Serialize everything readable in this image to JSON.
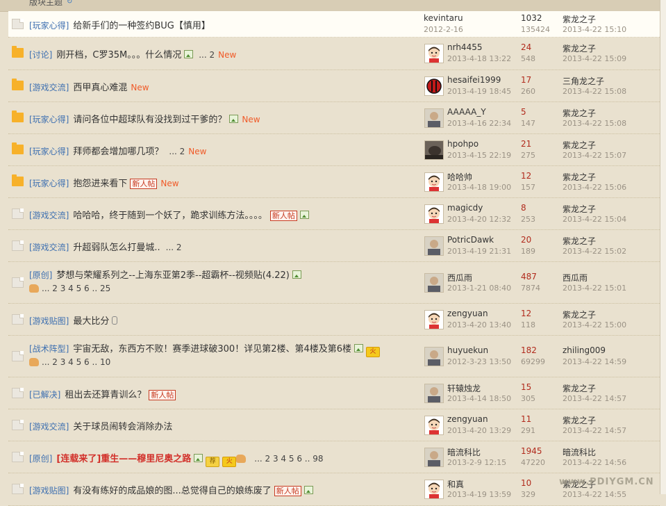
{
  "header": {
    "title": "版块主题"
  },
  "watermark": "www.PDIYGM.CN",
  "threads": [
    {
      "sticky": true,
      "folder": "gray",
      "category": "[玩家心得]",
      "title": "给新手们的一种签约BUG【慎用】",
      "author": "kevintaru",
      "date": "2012-2-16",
      "replies": "1032",
      "views": "135424",
      "last_user": "紫龙之子",
      "last_time": "2013-4-22 15:10",
      "avatar": "none"
    },
    {
      "folder": "yellow",
      "category": "[讨论]",
      "title": "刚开档，C罗35M。。。什么情况",
      "image": true,
      "pages": [
        "... 2"
      ],
      "new": "New",
      "author": "nrh4455",
      "date": "2013-4-18 13:22",
      "replies": "24",
      "views": "548",
      "last_user": "紫龙之子",
      "last_time": "2013-4-22 15:09",
      "avatar": "face"
    },
    {
      "folder": "yellow",
      "category": "[游戏交流]",
      "title": "西甲真心难混",
      "new": "New",
      "author": "hesaifei1999",
      "date": "2013-4-19 18:45",
      "replies": "17",
      "views": "260",
      "last_user": "三角龙之子",
      "last_time": "2013-4-22 15:08",
      "avatar": "milan"
    },
    {
      "folder": "yellow",
      "category": "[玩家心得]",
      "title": "请问各位中超球队有没找到过干爹的？",
      "image": true,
      "new": "New",
      "author": "AAAAA_Y",
      "date": "2013-4-16 22:34",
      "replies": "5",
      "views": "147",
      "last_user": "紫龙之子",
      "last_time": "2013-4-22 15:08",
      "avatar": "photo"
    },
    {
      "folder": "yellow",
      "category": "[玩家心得]",
      "title": "拜师都会增加哪几项？",
      "pages": [
        "... 2"
      ],
      "new": "New",
      "author": "hpohpo",
      "date": "2013-4-15 22:19",
      "replies": "21",
      "views": "275",
      "last_user": "紫龙之子",
      "last_time": "2013-4-22 15:07",
      "avatar": "dark"
    },
    {
      "folder": "yellow",
      "category": "[玩家心得]",
      "title": "抱怨进来看下",
      "badge": "新人帖",
      "new": "New",
      "author": "哈哈帅",
      "date": "2013-4-18 19:00",
      "replies": "12",
      "views": "157",
      "last_user": "紫龙之子",
      "last_time": "2013-4-22 15:06",
      "avatar": "face"
    },
    {
      "folder": "gray",
      "category": "[游戏交流]",
      "title": "哈哈哈，终于随到一个妖了，跪求训练方法。。。。",
      "badge": "新人帖",
      "image_after": true,
      "author": "magicdy",
      "date": "2013-4-20 12:32",
      "replies": "8",
      "views": "253",
      "last_user": "紫龙之子",
      "last_time": "2013-4-22 15:04",
      "avatar": "face"
    },
    {
      "folder": "gray",
      "category": "[游戏交流]",
      "title": "升超弱队怎么打曼城..",
      "pages": [
        "... 2"
      ],
      "author": "PotricDawk",
      "date": "2013-4-19 21:31",
      "replies": "20",
      "views": "189",
      "last_user": "紫龙之子",
      "last_time": "2013-4-22 15:02",
      "avatar": "photo"
    },
    {
      "folder": "gray",
      "category": "[原创]",
      "title": "梦想与荣耀系列之--上海东亚第2季--超霸杯--视频贴(4.22)",
      "image": true,
      "pages2": "... 2  3  4  5  6 .. 25",
      "author": "西瓜雨",
      "date": "2013-1-21 08:40",
      "replies": "487",
      "views": "7874",
      "last_user": "西瓜雨",
      "last_time": "2013-4-22 15:01",
      "avatar": "photo"
    },
    {
      "folder": "gray",
      "category": "[游戏贴图]",
      "title": "最大比分",
      "clip": true,
      "author": "zengyuan",
      "date": "2013-4-20 13:40",
      "replies": "12",
      "views": "118",
      "last_user": "紫龙之子",
      "last_time": "2013-4-22 15:00",
      "avatar": "face"
    },
    {
      "folder": "gray",
      "category": "[战术阵型]",
      "title": "宇宙无敌，东西方不败！赛季进球破300！详见第2楼、第4楼及第6楼",
      "image": true,
      "hot": "火",
      "pages2": "... 2  3  4  5  6 .. 10",
      "author": "huyuekun",
      "date": "2012-3-23 13:50",
      "replies": "182",
      "views": "69299",
      "last_user": "zhiling009",
      "last_time": "2013-4-22 14:59",
      "avatar": "photo"
    },
    {
      "folder": "gray",
      "category": "[已解决]",
      "title": "租出去还算青训么？",
      "badge": "新人帖",
      "author": "轩辕烛龙",
      "date": "2013-4-14 18:50",
      "replies": "15",
      "views": "305",
      "last_user": "紫龙之子",
      "last_time": "2013-4-22 14:57",
      "avatar": "photo"
    },
    {
      "folder": "gray",
      "category": "[游戏交流]",
      "title": "关于球员闹转会消除办法",
      "author": "zengyuan",
      "date": "2013-4-20 13:29",
      "replies": "11",
      "views": "291",
      "last_user": "紫龙之子",
      "last_time": "2013-4-22 14:57",
      "avatar": "face"
    },
    {
      "folder": "gray",
      "category": "[原创]",
      "title": "[连载来了]重生——穆里尼奥之路",
      "red": true,
      "image": true,
      "rec": "荐",
      "hot": "火",
      "hand": true,
      "pages": [
        "... 2  3  4  5  6 .. 98"
      ],
      "author": "暗流科比",
      "date": "2013-2-9 12:15",
      "replies": "1945",
      "views": "47220",
      "last_user": "暗流科比",
      "last_time": "2013-4-22 14:56",
      "avatar": "photo"
    },
    {
      "folder": "gray",
      "category": "[游戏贴图]",
      "title": "有没有练好的成品娘的图...总觉得自己的娘练废了",
      "badge": "新人帖",
      "image_after": true,
      "author": "和真",
      "date": "2013-4-19 13:59",
      "replies": "10",
      "views": "329",
      "last_user": "紫龙之子",
      "last_time": "2013-4-22 14:55",
      "avatar": "face"
    }
  ]
}
